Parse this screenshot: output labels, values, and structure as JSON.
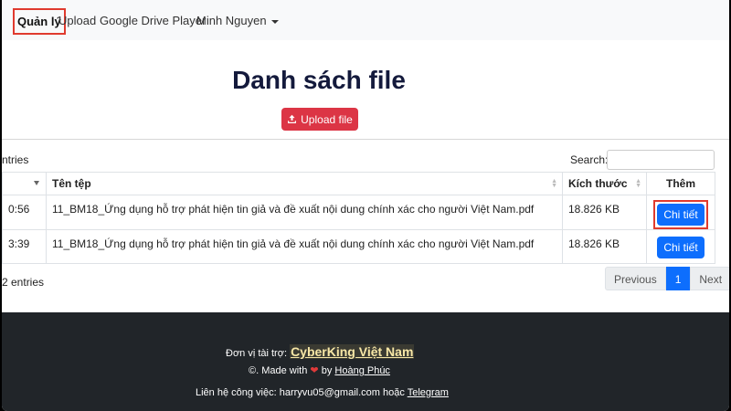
{
  "nav": {
    "brand": "Quản lý",
    "upload": "Upload",
    "player": "Google Drive Player",
    "user": "Minh Nguyen"
  },
  "main": {
    "title": "Danh sách file",
    "upload_button": "Upload file"
  },
  "table": {
    "entries_top": "ntries",
    "search_label": "Search:",
    "headers": [
      "",
      "Tên tệp",
      "Kích thước",
      "Thêm"
    ],
    "rows": [
      {
        "time": "0:56",
        "name": "11_BM18_Ứng dụng hỗ trợ phát hiện tin giả và đề xuất nội dung chính xác cho người Việt Nam.pdf",
        "size": "18.826 KB",
        "action": "Chi tiết"
      },
      {
        "time": "3:39",
        "name": "11_BM18_Ứng dụng hỗ trợ phát hiện tin giả và đề xuất nội dung chính xác cho người Việt Nam.pdf",
        "size": "18.826 KB",
        "action": "Chi tiết"
      }
    ],
    "entries_bottom": "2 entries"
  },
  "pagination": {
    "previous": "Previous",
    "page": "1",
    "next": "Next"
  },
  "footer": {
    "sponsor_label": "Đơn vị tài trợ:",
    "sponsor_name": "CyberKing Việt Nam",
    "made_prefix": "©. Made with",
    "heart": "❤",
    "made_by": "by",
    "author": "Hoàng Phúc",
    "contact_label": "Liên hệ công việc: harryvu05@gmail.com hoặc",
    "telegram": "Telegram"
  },
  "colors": {
    "danger": "#dc3545",
    "primary": "#0d6efd",
    "footer_bg": "#212529",
    "highlight": "#e03a2e"
  }
}
